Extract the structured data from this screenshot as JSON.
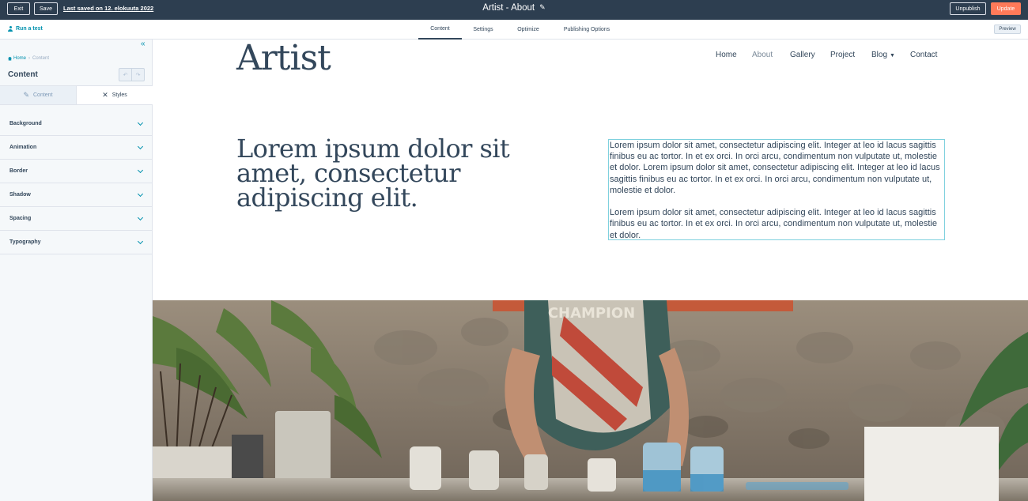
{
  "topbar": {
    "exit_label": "Exit",
    "save_label": "Save",
    "last_saved": "Last saved on 12. elokuuta 2022",
    "page_title": "Artist - About",
    "unpublish_label": "Unpublish",
    "update_label": "Update",
    "accent_color": "#ff7a59",
    "bg_color": "#2d3e50"
  },
  "subnav": {
    "run_test": "Run a test",
    "tabs": [
      {
        "label": "Content",
        "active": true
      },
      {
        "label": "Settings",
        "active": false
      },
      {
        "label": "Optimize",
        "active": false
      },
      {
        "label": "Publishing Options",
        "active": false
      }
    ],
    "preview_label": "Preview"
  },
  "sidebar": {
    "breadcrumb": {
      "home": "Home",
      "current": "Content"
    },
    "title": "Content",
    "tabs": [
      {
        "label": "Content",
        "icon": "pencil-icon",
        "active": false
      },
      {
        "label": "Styles",
        "icon": "styles-icon",
        "active": true
      }
    ],
    "sections": [
      {
        "label": "Background"
      },
      {
        "label": "Animation"
      },
      {
        "label": "Border"
      },
      {
        "label": "Shadow"
      },
      {
        "label": "Spacing"
      },
      {
        "label": "Typography"
      }
    ]
  },
  "site": {
    "logo": "Artist",
    "nav": [
      {
        "label": "Home"
      },
      {
        "label": "About",
        "active": true
      },
      {
        "label": "Gallery"
      },
      {
        "label": "Project"
      },
      {
        "label": "Blog",
        "has_dropdown": true
      },
      {
        "label": "Contact"
      }
    ],
    "heading": "Lorem ipsum dolor sit amet, consectetur adipiscing elit.",
    "paragraphs": [
      "Lorem ipsum dolor sit amet, consectetur adipiscing elit. Integer at leo id lacus sagittis finibus eu ac tortor. In et ex orci. In orci arcu, condimentum non vulputate ut, molestie et dolor. Lorem ipsum dolor sit amet, consectetur adipiscing elit. Integer at leo id lacus sagittis finibus eu ac tortor. In et ex orci. In orci arcu, condimentum non vulputate ut, molestie et dolor.",
      "Lorem ipsum dolor sit amet, consectetur adipiscing elit. Integer at leo id lacus sagittis finibus eu ac tortor. In et ex orci. In orci arcu, condimentum non vulputate ut, molestie et dolor."
    ],
    "photo_text": "CHAMPION"
  }
}
